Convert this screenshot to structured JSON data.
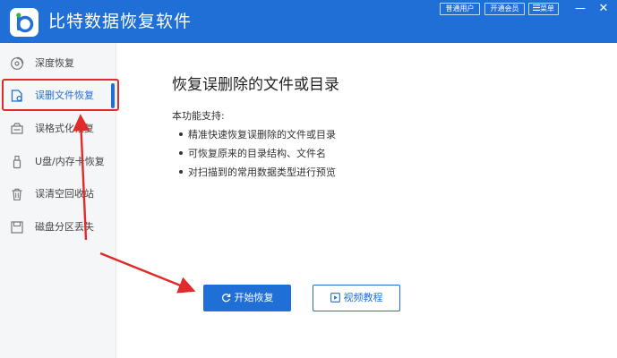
{
  "app": {
    "title": "比特数据恢复软件",
    "brand_color": "#1f6fd6"
  },
  "titlebar": {
    "btn_normal_user": "普通用户",
    "btn_open_vip": "开通会员",
    "btn_menu": "菜单",
    "menu_icon": "hamburger-icon",
    "minimize_glyph": "—",
    "close_glyph": "✕"
  },
  "sidebar": {
    "items": [
      {
        "label": "深度恢复",
        "icon": "disc-scan-icon"
      },
      {
        "label": "误删文件恢复",
        "icon": "file-restore-icon",
        "active": true
      },
      {
        "label": "误格式化恢复",
        "icon": "format-drive-icon"
      },
      {
        "label": "U盘/内存卡恢复",
        "icon": "usb-drive-icon"
      },
      {
        "label": "误清空回收站",
        "icon": "recycle-bin-icon"
      },
      {
        "label": "磁盘分区丢失",
        "icon": "disk-partition-icon"
      }
    ]
  },
  "main": {
    "title": "恢复误删除的文件或目录",
    "support_label": "本功能支持:",
    "features": [
      "精准快速恢复误删除的文件或目录",
      "可恢复原来的目录结构、文件名",
      "对扫描到的常用数据类型进行预览"
    ],
    "start_button": "开始恢复",
    "tutorial_button": "视频教程"
  },
  "annotation": {
    "highlight_color": "#e02b2b"
  }
}
